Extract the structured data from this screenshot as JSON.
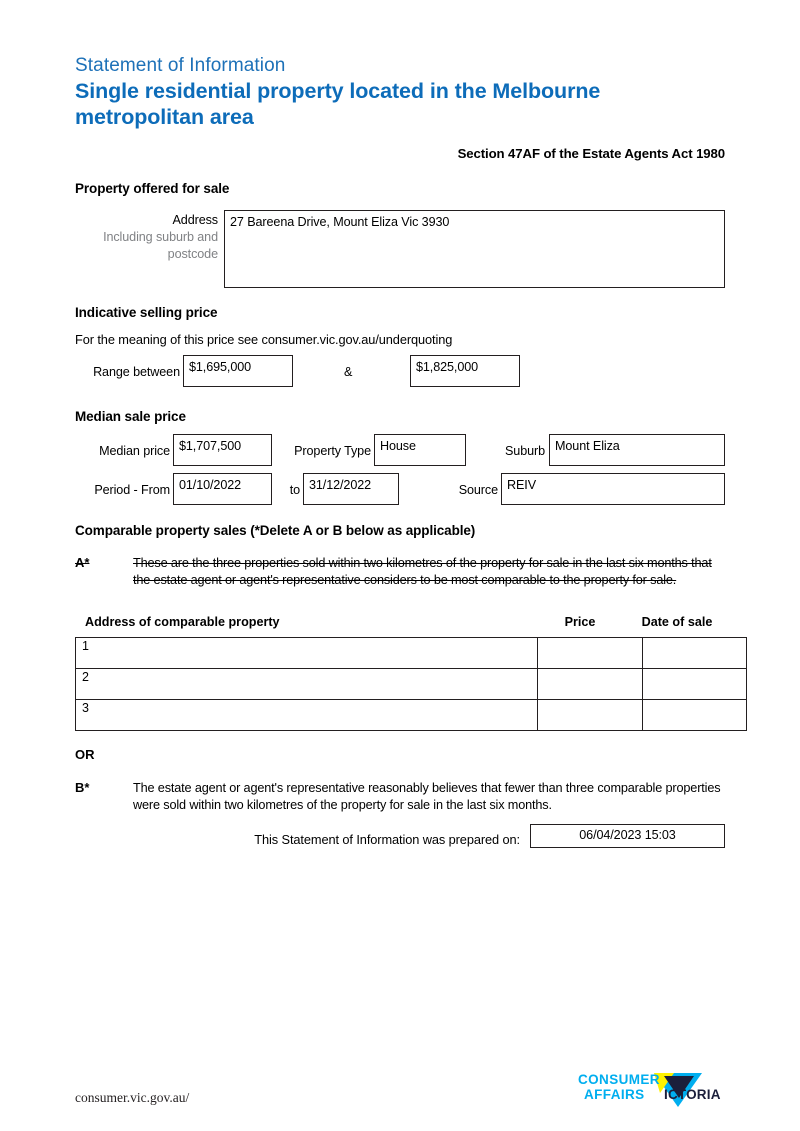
{
  "header": {
    "kicker": "Statement of Information",
    "title": "Single residential property located in the Melbourne metropolitan area",
    "act_reference": "Section 47AF of the Estate Agents Act 1980"
  },
  "property_offered": {
    "heading": "Property offered for sale",
    "address_label": "Address",
    "address_label_sub": "Including suburb and postcode",
    "address_value": "27 Bareena Drive, Mount Eliza Vic 3930"
  },
  "indicative_price": {
    "heading": "Indicative selling price",
    "note": "For the meaning of this price see consumer.vic.gov.au/underquoting",
    "range_label": "Range between",
    "range_low": "$1,695,000",
    "separator": "&",
    "range_high": "$1,825,000"
  },
  "median_sale_price": {
    "heading": "Median sale price",
    "median_price_label": "Median price",
    "median_price_value": "$1,707,500",
    "property_type_label": "Property Type",
    "property_type_value": "House",
    "suburb_label": "Suburb",
    "suburb_value": "Mount Eliza",
    "period_from_label": "Period - From",
    "period_from_value": "01/10/2022",
    "period_to_label": "to",
    "period_to_value": "31/12/2022",
    "source_label": "Source",
    "source_value": "REIV"
  },
  "comparable_sales": {
    "heading": "Comparable property sales (*Delete A or B below as applicable)",
    "option_a_marker": "A*",
    "option_a_text": "These are the three properties sold within two kilometres of the property for sale in the last six months that the estate agent or agent's representative considers to be most comparable to the property for sale.",
    "option_a_struck": true,
    "columns": {
      "address": "Address of comparable property",
      "price": "Price",
      "date": "Date of sale"
    },
    "rows": [
      {
        "num": "1",
        "address": "",
        "price": "",
        "date": ""
      },
      {
        "num": "2",
        "address": "",
        "price": "",
        "date": ""
      },
      {
        "num": "3",
        "address": "",
        "price": "",
        "date": ""
      }
    ],
    "or_label": "OR",
    "option_b_marker": "B*",
    "option_b_text": "The estate agent or agent's representative reasonably believes that fewer than three comparable properties were sold within two kilometres of the property for sale in the last six months."
  },
  "prepared": {
    "label": "This Statement of Information was prepared on:",
    "value": "06/04/2023 15:03"
  },
  "footer": {
    "url": "consumer.vic.gov.au/",
    "logo_line1": "CONSUMER",
    "logo_line2": "AFFAIRS",
    "logo_line3": "VICTORIA"
  },
  "colors": {
    "kicker_blue": "#1d71b8",
    "title_blue": "#0d6cb9",
    "border": "#231f20",
    "muted_label": "#808285",
    "logo_cyan": "#00aeef",
    "logo_yellow": "#fff200",
    "logo_navy": "#1b1f3b"
  }
}
